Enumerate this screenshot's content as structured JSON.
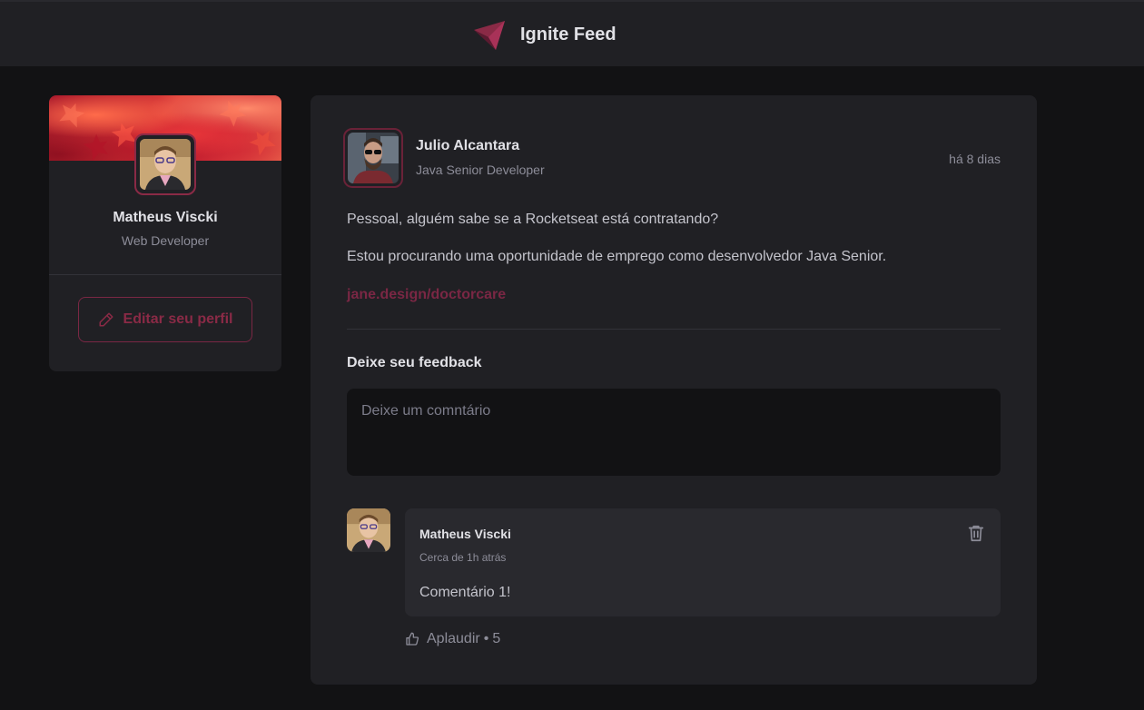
{
  "header": {
    "title": "Ignite Feed",
    "logo_icon": "ignite-logo-icon"
  },
  "profile": {
    "name": "Matheus Viscki",
    "role": "Web Developer",
    "edit_label": "Editar seu perfil"
  },
  "post": {
    "author": {
      "name": "Julio Alcantara",
      "role": "Java Senior Developer"
    },
    "time": "há 8 dias",
    "content": [
      "Pessoal, alguém sabe se a Rocketseat está contratando?",
      "Estou procurando uma oportunidade de emprego como desenvolvedor Java Senior."
    ],
    "link": "jane.design/doctorcare"
  },
  "feedback": {
    "title": "Deixe seu feedback",
    "placeholder": "Deixe um comntário",
    "value": ""
  },
  "comments": [
    {
      "author": "Matheus Viscki",
      "time": "Cerca de 1h atrás",
      "text": "Comentário 1!",
      "applaud_label": "Aplaudir",
      "applaud_separator": "•",
      "applaud_count": "5"
    }
  ],
  "colors": {
    "background": "#121214",
    "surface": "#202024",
    "accent": "#7a2744",
    "text": "#e1e1e6",
    "muted": "#8d8d99"
  }
}
